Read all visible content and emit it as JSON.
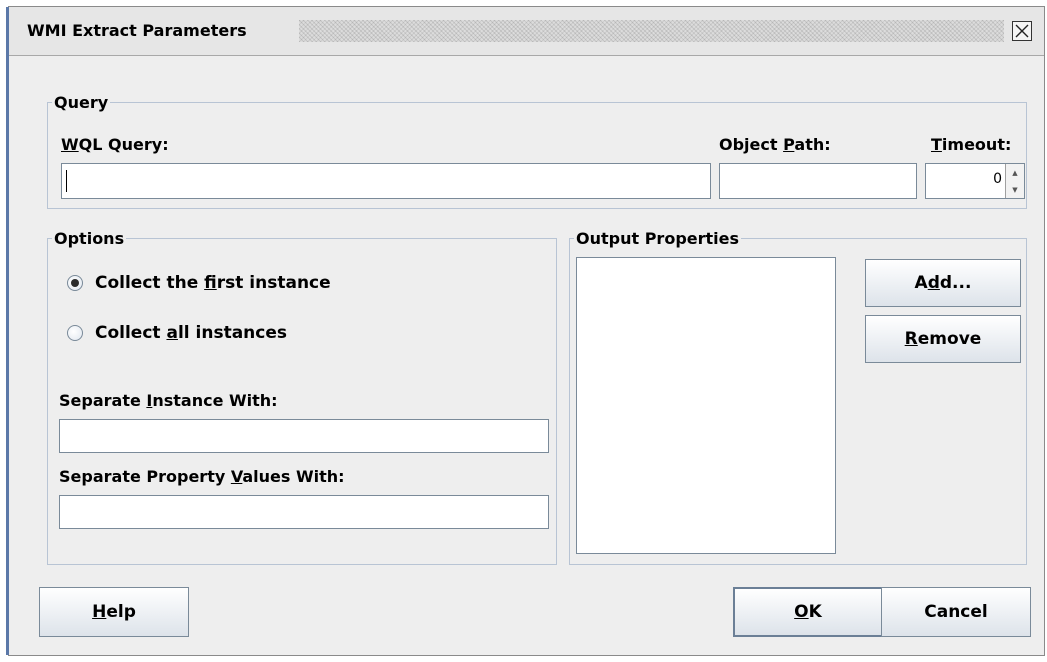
{
  "window": {
    "title": "WMI Extract Parameters",
    "close_icon": "close-icon"
  },
  "query": {
    "legend": "Query",
    "wql_label_pre": "",
    "wql_label_u": "W",
    "wql_label_post": "QL Query:",
    "wql_value": "",
    "path_label_pre": "Object ",
    "path_label_u": "P",
    "path_label_post": "ath:",
    "path_value": "",
    "timeout_label_pre": "",
    "timeout_label_u": "T",
    "timeout_label_post": "imeout:",
    "timeout_value": "0"
  },
  "options": {
    "legend": "Options",
    "radio_first_pre": "Collect the ",
    "radio_first_u": "f",
    "radio_first_post": "irst instance",
    "radio_first_checked": true,
    "radio_all_pre": "Collect ",
    "radio_all_u": "a",
    "radio_all_post": "ll instances",
    "radio_all_checked": false,
    "sep_instance_pre": "Separate ",
    "sep_instance_u": "I",
    "sep_instance_post": "nstance With:",
    "sep_instance_value": "",
    "sep_property_pre": "Separate Property ",
    "sep_property_u": "V",
    "sep_property_post": "alues With:",
    "sep_property_value": ""
  },
  "output": {
    "legend": "Output Properties",
    "add_pre": "A",
    "add_u": "d",
    "add_post": "d...",
    "remove_pre": "",
    "remove_u": "R",
    "remove_post": "emove",
    "items": []
  },
  "footer": {
    "help_pre": "",
    "help_u": "H",
    "help_post": "elp",
    "ok_pre": "",
    "ok_u": "O",
    "ok_post": "K",
    "cancel": "Cancel"
  },
  "colors": {
    "title_bar": "#e6e6e6",
    "dialog_bg": "#eeeeee",
    "group_border": "#b8c4d4",
    "accent": "#5b78a8"
  }
}
